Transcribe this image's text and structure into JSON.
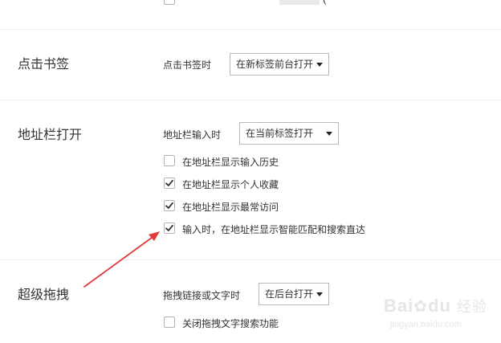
{
  "top_row": {
    "partial_text": "(",
    "checked": false
  },
  "sections": {
    "bookmark": {
      "title": "点击书签",
      "label": "点击书签时",
      "select_value": "在新标签前台打开"
    },
    "addressbar": {
      "title": "地址栏打开",
      "label": "地址栏输入时",
      "select_value": "在当前标签打开",
      "options": [
        {
          "label": "在地址栏显示输入历史",
          "checked": false
        },
        {
          "label": "在地址栏显示个人收藏",
          "checked": true
        },
        {
          "label": "在地址栏显示最常访问",
          "checked": true
        },
        {
          "label": "输入时，在地址栏显示智能匹配和搜索直达",
          "checked": true
        }
      ]
    },
    "dragdrop": {
      "title": "超级拖拽",
      "label": "拖拽链接或文字时",
      "select_value": "在后台打开",
      "options": [
        {
          "label": "关闭拖拽文字搜索功能",
          "checked": false
        }
      ]
    }
  },
  "annotation": {
    "arrow_color": "#e23b3b"
  },
  "watermark": {
    "brand": "Bai",
    "brand2": "du",
    "sub": "经验",
    "url": "jingyan.baidu.com"
  }
}
